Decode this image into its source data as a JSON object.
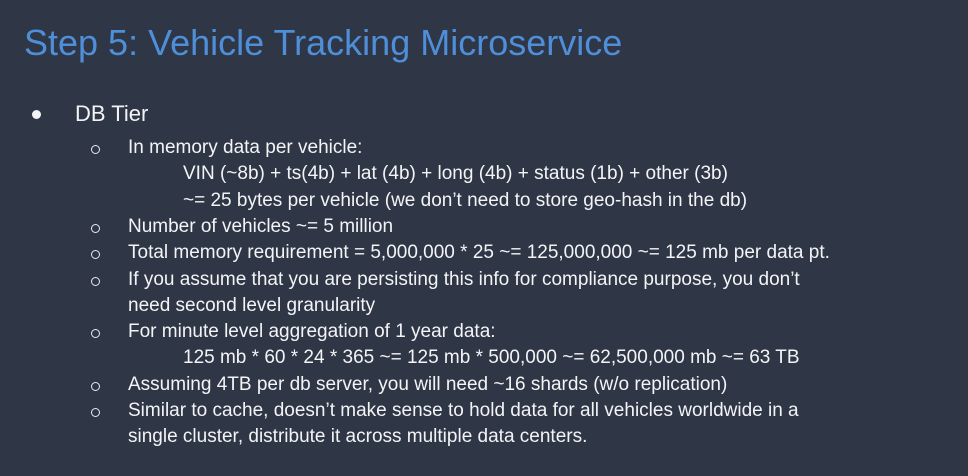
{
  "title": "Step 5: Vehicle Tracking Microservice",
  "section": "DB Tier",
  "lines": [
    {
      "kind": "bullet",
      "text": "In memory data per vehicle:"
    },
    {
      "kind": "sub",
      "text": "VIN (~8b) + ts(4b) + lat (4b) + long (4b) + status (1b) + other (3b)"
    },
    {
      "kind": "sub",
      "text": "~= 25 bytes per vehicle (we don’t need to store geo-hash in the db)"
    },
    {
      "kind": "bullet",
      "text": "Number of vehicles ~= 5 million"
    },
    {
      "kind": "bullet",
      "text": "Total memory requirement = 5,000,000 * 25 ~= 125,000,000 ~= 125 mb per data pt."
    },
    {
      "kind": "bullet",
      "text": "If you assume that you are persisting this info for compliance purpose, you don’t"
    },
    {
      "kind": "cont",
      "text": "need second level granularity"
    },
    {
      "kind": "bullet",
      "text": "For minute level aggregation of 1 year data:"
    },
    {
      "kind": "sub",
      "text": "125 mb * 60 * 24 * 365 ~= 125 mb * 500,000 ~= 62,500,000 mb ~= 63 TB"
    },
    {
      "kind": "bullet",
      "text": "Assuming 4TB per db server, you will need ~16 shards (w/o replication)"
    },
    {
      "kind": "bullet",
      "text": "Similar to cache, doesn’t make sense to hold data for all vehicles worldwide in a"
    },
    {
      "kind": "cont",
      "text": "single cluster, distribute it across multiple data centers."
    }
  ]
}
